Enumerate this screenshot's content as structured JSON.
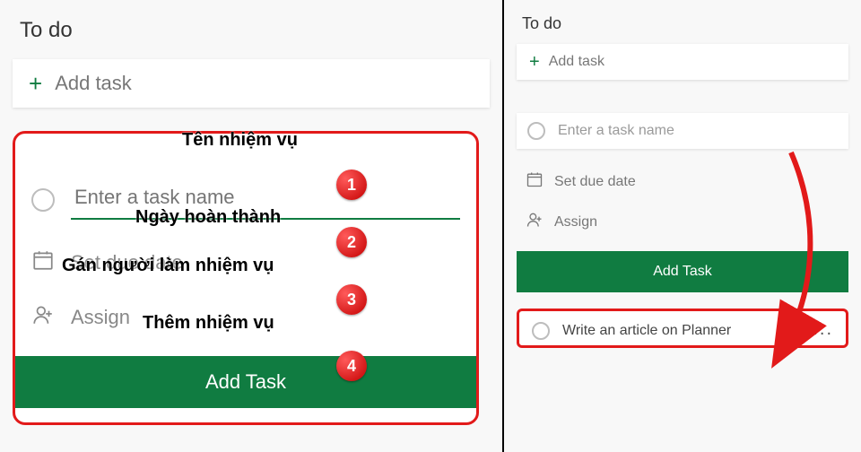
{
  "colors": {
    "accent": "#107c41",
    "annotation_red": "#e21a1a"
  },
  "left": {
    "title": "To do",
    "add_task_label": "Add task",
    "form": {
      "task_name_placeholder": "Enter a task name",
      "due_date_label": "Set due date",
      "assign_label": "Assign",
      "submit_label": "Add Task"
    },
    "annotations": {
      "task_name": "Tên nhiệm vụ",
      "due_date": "Ngày hoàn thành",
      "assign": "Gán người làm nhiệm vụ",
      "submit": "Thêm nhiệm vụ",
      "badge1": "1",
      "badge2": "2",
      "badge3": "3",
      "badge4": "4"
    }
  },
  "right": {
    "title": "To do",
    "add_task_label": "Add task",
    "form": {
      "task_name_placeholder": "Enter a task name",
      "due_date_label": "Set due date",
      "assign_label": "Assign",
      "submit_label": "Add Task"
    },
    "task": {
      "title": "Write an article on Planner",
      "more": "..."
    }
  }
}
